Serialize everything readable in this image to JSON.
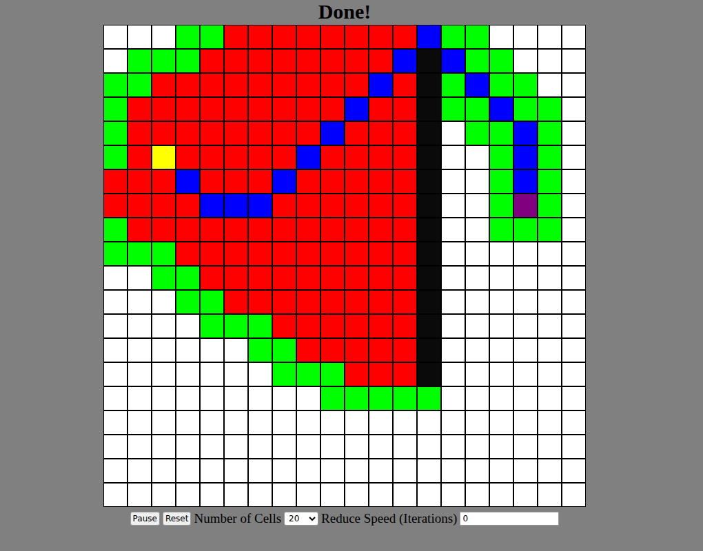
{
  "window": {
    "title": "Done!"
  },
  "legend": {
    "W": {
      "kind": "empty",
      "color": "#ffffff"
    },
    "G": {
      "kind": "frontier",
      "color": "#00ff00"
    },
    "R": {
      "kind": "visited",
      "color": "#ff0000"
    },
    "B": {
      "kind": "path",
      "color": "#0000ff"
    },
    "K": {
      "kind": "wall",
      "color": "#0a0a0a"
    },
    "Y": {
      "kind": "start",
      "color": "#ffff00"
    },
    "P": {
      "kind": "end",
      "color": "#800080"
    }
  },
  "grid": [
    "WWWGGRRRRRRRRBGGWWWW",
    "WGGGRRRRRRRRBKBGGWWW",
    "GGRRRRRRRRRBRKGBGGWW",
    "GRRRRRRRRRBRRKGGBGGW",
    "GRRRRRRRRBRRRKWGGBGW",
    "GRYRRRRRBRRRRKWWGBGW",
    "RRRBRRRBRRRRRKWWGBGW",
    "RRRRBBBRRRRRRKWWGPGW",
    "GRRRRRRRRRRRRKWWGGGW",
    "GGGRRRRRRRRRRKWWWWWW",
    "WWGGRRRRRRRRRKWWWWWW",
    "WWWGGRRRRRRRRKWWWWWW",
    "WWWWGGGRRRRRRKWWWWWW",
    "WWWWWWGGRRRRRKWWWWWW",
    "WWWWWWWGGGRRRKWWWWWW",
    "WWWWWWWWWGGGGGWWWWWW",
    "WWWWWWWWWWWWWWWWWWWW",
    "WWWWWWWWWWWWWWWWWWWW",
    "WWWWWWWWWWWWWWWWWWWW",
    "WWWWWWWWWWWWWWWWWWWW"
  ],
  "controls": {
    "buttons": [
      "Pause",
      "Reset"
    ],
    "cells_label": "Number of Cells",
    "cells_value": "20",
    "speed_label": "Reduce Speed (Iterations)",
    "speed_value": "0"
  }
}
